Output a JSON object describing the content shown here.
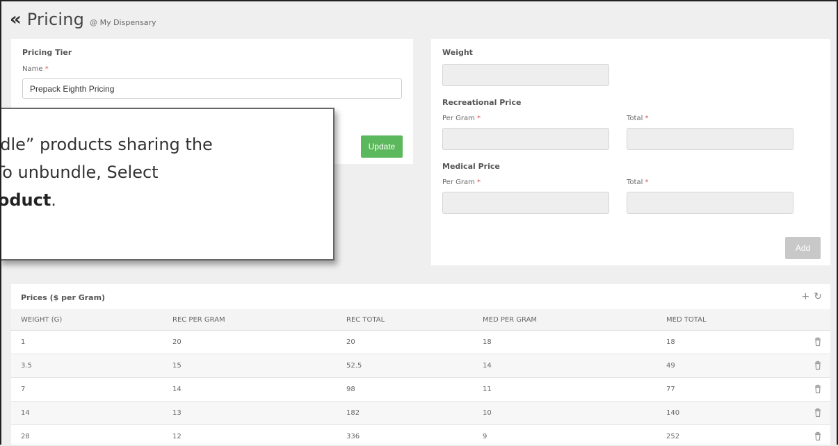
{
  "header": {
    "back_icon": "«",
    "title": "Pricing",
    "subtitle": "@ My Dispensary"
  },
  "pricing_tier": {
    "section_label": "Pricing Tier",
    "name_label": "Name",
    "required_mark": "*",
    "name_value": "Prepack Eighth Pricing",
    "update_label": "Update"
  },
  "weight_form": {
    "weight_label": "Weight",
    "rec_label": "Recreational Price",
    "med_label": "Medical Price",
    "per_gram_label": "Per Gram",
    "total_label": "Total",
    "add_label": "Add"
  },
  "prices": {
    "title": "Prices ($ per Gram)",
    "tools": {
      "add_icon": "+",
      "refresh_icon": "↻"
    },
    "columns": [
      "WEIGHT (G)",
      "REC PER GRAM",
      "REC TOTAL",
      "MED PER GRAM",
      "MED TOTAL"
    ],
    "rows": [
      [
        "1",
        "20",
        "20",
        "18",
        "18"
      ],
      [
        "3.5",
        "15",
        "52.5",
        "14",
        "49"
      ],
      [
        "7",
        "14",
        "98",
        "11",
        "77"
      ],
      [
        "14",
        "13",
        "182",
        "10",
        "140"
      ],
      [
        "28",
        "12",
        "336",
        "9",
        "252"
      ]
    ]
  },
  "tooltip": {
    "line1": "ndle” products sharing the",
    "line2": " To unbundle, Select",
    "line3_bold": "roduct",
    "line3_tail": "."
  },
  "colors": {
    "update_green": "#5cb85c",
    "required_red": "#d9534f",
    "add_disabled": "#c8c8c8"
  }
}
